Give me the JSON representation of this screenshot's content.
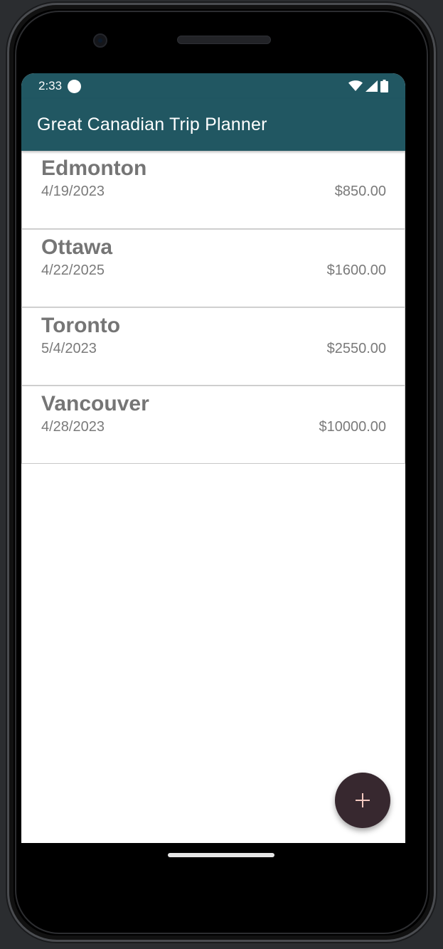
{
  "status_bar": {
    "time": "2:33"
  },
  "app_bar": {
    "title": "Great Canadian Trip Planner",
    "color": "#215762"
  },
  "trips": [
    {
      "name": "Edmonton",
      "date": "4/19/2023",
      "cost": "$850.00"
    },
    {
      "name": "Ottawa",
      "date": "4/22/2025",
      "cost": "$1600.00"
    },
    {
      "name": "Toronto",
      "date": "5/4/2023",
      "cost": "$2550.00"
    },
    {
      "name": "Vancouver",
      "date": "4/28/2023",
      "cost": "$10000.00"
    }
  ],
  "fab": {
    "icon": "plus-icon",
    "color": "#37282f"
  }
}
